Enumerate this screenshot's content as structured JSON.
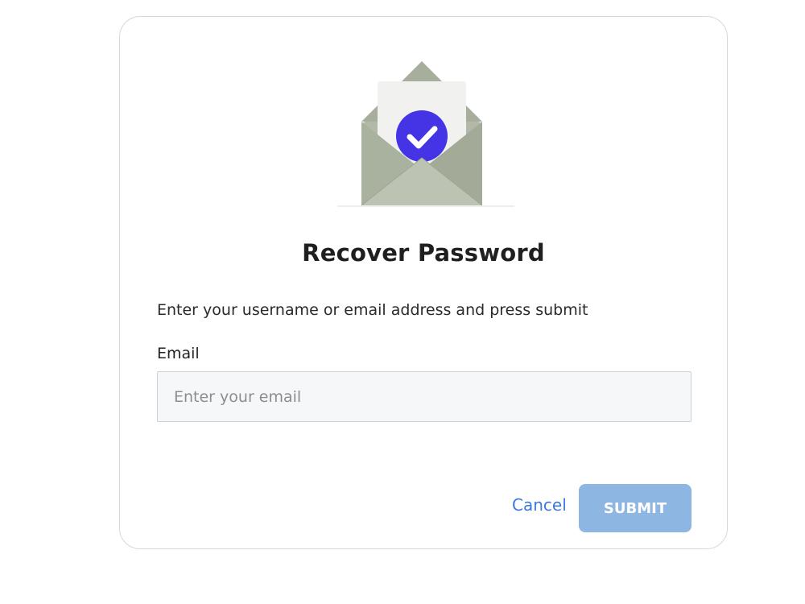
{
  "dialog": {
    "title": "Recover Password",
    "instructions": "Enter your username or email address and press submit",
    "illustration_icon": "envelope-check-icon",
    "colors": {
      "accent_check": "#4534e6",
      "envelope": "#a7af9c",
      "link": "#3b78e0",
      "submit_disabled": "#8eb6e3"
    }
  },
  "form": {
    "email_label": "Email",
    "email_value": "",
    "email_placeholder": "Enter your email"
  },
  "actions": {
    "cancel_label": "Cancel",
    "submit_label": "SUBMIT"
  }
}
